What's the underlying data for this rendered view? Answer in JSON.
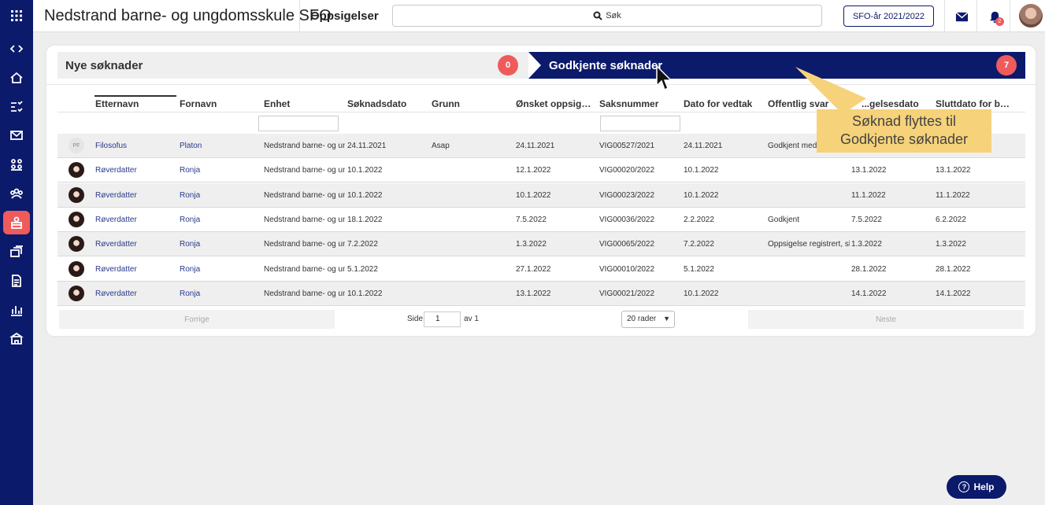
{
  "header": {
    "app_title": "Nedstrand barne- og ungdomsskule SFO",
    "page_title": "Oppsigelser",
    "search_placeholder": "Søk",
    "year_button": "SFO-år 2021/2022",
    "notification_count": "2"
  },
  "tabs": {
    "new_label": "Nye søknader",
    "new_count": "0",
    "approved_label": "Godkjente søknader",
    "approved_count": "7"
  },
  "table": {
    "columns": [
      "Etternavn",
      "Fornavn",
      "Enhet",
      "Søknadsdato",
      "Grunn",
      "Ønsket oppsigel...",
      "Saksnummer",
      "Dato for vedtak",
      "Offentlig svar",
      "...gelsesdato",
      "Sluttdato for bet..."
    ],
    "rows": [
      {
        "avatar": "PF",
        "etternavn": "Filosofus",
        "fornavn": "Platon",
        "enhet": "Nedstrand barne- og un",
        "soknadsdato": "24.11.2021",
        "grunn": "Asap",
        "onsket": "24.11.2021",
        "saksnummer": "VIG00527/2021",
        "vedtak": "24.11.2021",
        "svar": "Godkjent med",
        "oppsigelsesdato": "",
        "sluttdato": ""
      },
      {
        "avatar": "",
        "etternavn": "Røverdatter",
        "fornavn": "Ronja",
        "enhet": "Nedstrand barne- og un",
        "soknadsdato": "10.1.2022",
        "grunn": "",
        "onsket": "12.1.2022",
        "saksnummer": "VIG00020/2022",
        "vedtak": "10.1.2022",
        "svar": "",
        "oppsigelsesdato": "13.1.2022",
        "sluttdato": "13.1.2022"
      },
      {
        "avatar": "",
        "etternavn": "Røverdatter",
        "fornavn": "Ronja",
        "enhet": "Nedstrand barne- og un",
        "soknadsdato": "10.1.2022",
        "grunn": "",
        "onsket": "10.1.2022",
        "saksnummer": "VIG00023/2022",
        "vedtak": "10.1.2022",
        "svar": "",
        "oppsigelsesdato": "11.1.2022",
        "sluttdato": "11.1.2022"
      },
      {
        "avatar": "",
        "etternavn": "Røverdatter",
        "fornavn": "Ronja",
        "enhet": "Nedstrand barne- og un",
        "soknadsdato": "18.1.2022",
        "grunn": "",
        "onsket": "7.5.2022",
        "saksnummer": "VIG00036/2022",
        "vedtak": "2.2.2022",
        "svar": "Godkjent",
        "oppsigelsesdato": "7.5.2022",
        "sluttdato": "6.2.2022"
      },
      {
        "avatar": "",
        "etternavn": "Røverdatter",
        "fornavn": "Ronja",
        "enhet": "Nedstrand barne- og un",
        "soknadsdato": "7.2.2022",
        "grunn": "",
        "onsket": "1.3.2022",
        "saksnummer": "VIG00065/2022",
        "vedtak": "7.2.2022",
        "svar": "Oppsigelse registrert, slu",
        "oppsigelsesdato": "1.3.2022",
        "sluttdato": "1.3.2022"
      },
      {
        "avatar": "",
        "etternavn": "Røverdatter",
        "fornavn": "Ronja",
        "enhet": "Nedstrand barne- og un",
        "soknadsdato": "5.1.2022",
        "grunn": "",
        "onsket": "27.1.2022",
        "saksnummer": "VIG00010/2022",
        "vedtak": "5.1.2022",
        "svar": "",
        "oppsigelsesdato": "28.1.2022",
        "sluttdato": "28.1.2022"
      },
      {
        "avatar": "",
        "etternavn": "Røverdatter",
        "fornavn": "Ronja",
        "enhet": "Nedstrand barne- og un",
        "soknadsdato": "10.1.2022",
        "grunn": "",
        "onsket": "13.1.2022",
        "saksnummer": "VIG00021/2022",
        "vedtak": "10.1.2022",
        "svar": "",
        "oppsigelsesdato": "14.1.2022",
        "sluttdato": "14.1.2022"
      }
    ]
  },
  "pager": {
    "prev": "Forrige",
    "side": "Side",
    "page": "1",
    "of": "av 1",
    "rows_option": "20 rader",
    "next": "Neste"
  },
  "callout": {
    "line1": "Søknad flyttes til",
    "line2": "Godkjente søknader"
  },
  "help": "Help",
  "colors": {
    "navy": "#0b1a6b",
    "accent_red": "#ef5b5b",
    "callout_yellow": "#f6d27a"
  }
}
